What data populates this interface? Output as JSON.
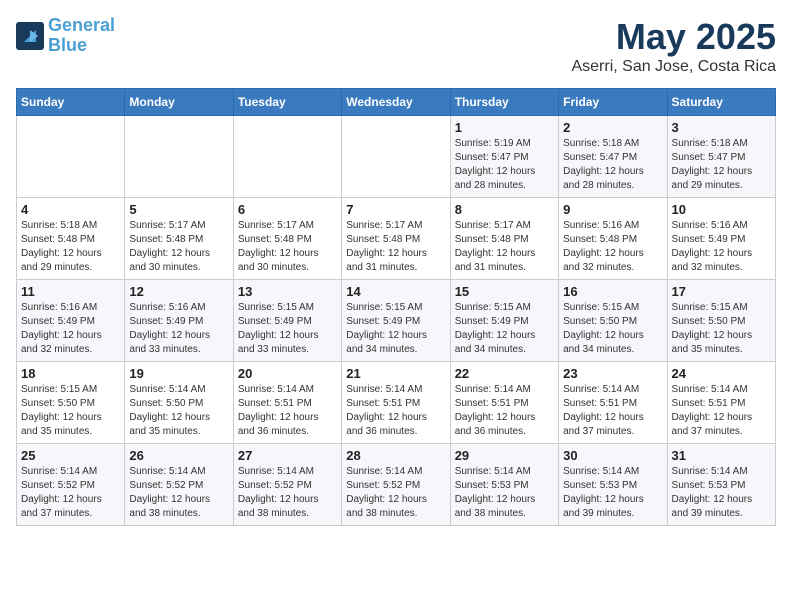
{
  "header": {
    "logo_line1": "General",
    "logo_line2": "Blue",
    "month": "May 2025",
    "location": "Aserri, San Jose, Costa Rica"
  },
  "weekdays": [
    "Sunday",
    "Monday",
    "Tuesday",
    "Wednesday",
    "Thursday",
    "Friday",
    "Saturday"
  ],
  "weeks": [
    [
      {
        "day": "",
        "info": ""
      },
      {
        "day": "",
        "info": ""
      },
      {
        "day": "",
        "info": ""
      },
      {
        "day": "",
        "info": ""
      },
      {
        "day": "1",
        "info": "Sunrise: 5:19 AM\nSunset: 5:47 PM\nDaylight: 12 hours\nand 28 minutes."
      },
      {
        "day": "2",
        "info": "Sunrise: 5:18 AM\nSunset: 5:47 PM\nDaylight: 12 hours\nand 28 minutes."
      },
      {
        "day": "3",
        "info": "Sunrise: 5:18 AM\nSunset: 5:47 PM\nDaylight: 12 hours\nand 29 minutes."
      }
    ],
    [
      {
        "day": "4",
        "info": "Sunrise: 5:18 AM\nSunset: 5:48 PM\nDaylight: 12 hours\nand 29 minutes."
      },
      {
        "day": "5",
        "info": "Sunrise: 5:17 AM\nSunset: 5:48 PM\nDaylight: 12 hours\nand 30 minutes."
      },
      {
        "day": "6",
        "info": "Sunrise: 5:17 AM\nSunset: 5:48 PM\nDaylight: 12 hours\nand 30 minutes."
      },
      {
        "day": "7",
        "info": "Sunrise: 5:17 AM\nSunset: 5:48 PM\nDaylight: 12 hours\nand 31 minutes."
      },
      {
        "day": "8",
        "info": "Sunrise: 5:17 AM\nSunset: 5:48 PM\nDaylight: 12 hours\nand 31 minutes."
      },
      {
        "day": "9",
        "info": "Sunrise: 5:16 AM\nSunset: 5:48 PM\nDaylight: 12 hours\nand 32 minutes."
      },
      {
        "day": "10",
        "info": "Sunrise: 5:16 AM\nSunset: 5:49 PM\nDaylight: 12 hours\nand 32 minutes."
      }
    ],
    [
      {
        "day": "11",
        "info": "Sunrise: 5:16 AM\nSunset: 5:49 PM\nDaylight: 12 hours\nand 32 minutes."
      },
      {
        "day": "12",
        "info": "Sunrise: 5:16 AM\nSunset: 5:49 PM\nDaylight: 12 hours\nand 33 minutes."
      },
      {
        "day": "13",
        "info": "Sunrise: 5:15 AM\nSunset: 5:49 PM\nDaylight: 12 hours\nand 33 minutes."
      },
      {
        "day": "14",
        "info": "Sunrise: 5:15 AM\nSunset: 5:49 PM\nDaylight: 12 hours\nand 34 minutes."
      },
      {
        "day": "15",
        "info": "Sunrise: 5:15 AM\nSunset: 5:49 PM\nDaylight: 12 hours\nand 34 minutes."
      },
      {
        "day": "16",
        "info": "Sunrise: 5:15 AM\nSunset: 5:50 PM\nDaylight: 12 hours\nand 34 minutes."
      },
      {
        "day": "17",
        "info": "Sunrise: 5:15 AM\nSunset: 5:50 PM\nDaylight: 12 hours\nand 35 minutes."
      }
    ],
    [
      {
        "day": "18",
        "info": "Sunrise: 5:15 AM\nSunset: 5:50 PM\nDaylight: 12 hours\nand 35 minutes."
      },
      {
        "day": "19",
        "info": "Sunrise: 5:14 AM\nSunset: 5:50 PM\nDaylight: 12 hours\nand 35 minutes."
      },
      {
        "day": "20",
        "info": "Sunrise: 5:14 AM\nSunset: 5:51 PM\nDaylight: 12 hours\nand 36 minutes."
      },
      {
        "day": "21",
        "info": "Sunrise: 5:14 AM\nSunset: 5:51 PM\nDaylight: 12 hours\nand 36 minutes."
      },
      {
        "day": "22",
        "info": "Sunrise: 5:14 AM\nSunset: 5:51 PM\nDaylight: 12 hours\nand 36 minutes."
      },
      {
        "day": "23",
        "info": "Sunrise: 5:14 AM\nSunset: 5:51 PM\nDaylight: 12 hours\nand 37 minutes."
      },
      {
        "day": "24",
        "info": "Sunrise: 5:14 AM\nSunset: 5:51 PM\nDaylight: 12 hours\nand 37 minutes."
      }
    ],
    [
      {
        "day": "25",
        "info": "Sunrise: 5:14 AM\nSunset: 5:52 PM\nDaylight: 12 hours\nand 37 minutes."
      },
      {
        "day": "26",
        "info": "Sunrise: 5:14 AM\nSunset: 5:52 PM\nDaylight: 12 hours\nand 38 minutes."
      },
      {
        "day": "27",
        "info": "Sunrise: 5:14 AM\nSunset: 5:52 PM\nDaylight: 12 hours\nand 38 minutes."
      },
      {
        "day": "28",
        "info": "Sunrise: 5:14 AM\nSunset: 5:52 PM\nDaylight: 12 hours\nand 38 minutes."
      },
      {
        "day": "29",
        "info": "Sunrise: 5:14 AM\nSunset: 5:53 PM\nDaylight: 12 hours\nand 38 minutes."
      },
      {
        "day": "30",
        "info": "Sunrise: 5:14 AM\nSunset: 5:53 PM\nDaylight: 12 hours\nand 39 minutes."
      },
      {
        "day": "31",
        "info": "Sunrise: 5:14 AM\nSunset: 5:53 PM\nDaylight: 12 hours\nand 39 minutes."
      }
    ]
  ]
}
